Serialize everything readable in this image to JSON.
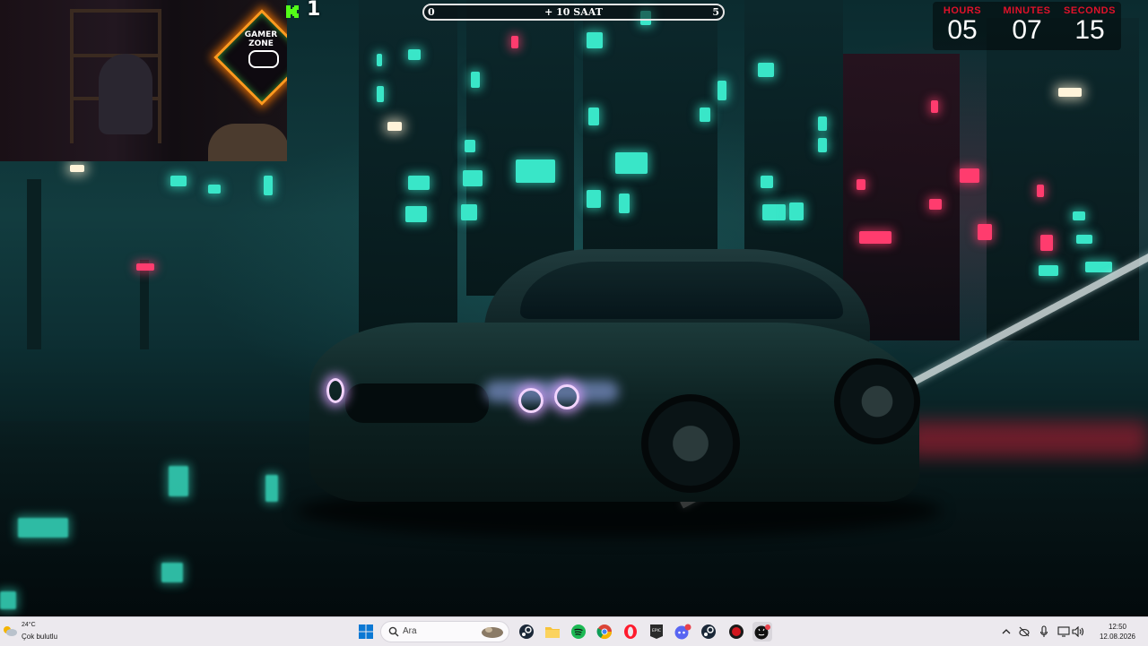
{
  "stream_overlay": {
    "kick_count": "1",
    "progress": {
      "start": "0",
      "end": "5",
      "label": "+ 10 SAAT",
      "fraction": 0.0
    },
    "countdown": {
      "hours_label": "HOURS",
      "hours": "05",
      "minutes_label": "MINUTES",
      "minutes": "07",
      "seconds_label": "SECONDS",
      "seconds": "15"
    },
    "webcam": {
      "sign_text_1": "GAMER",
      "sign_text_2": "ZONE"
    }
  },
  "taskbar": {
    "weather": {
      "temp": "24°C",
      "desc": "Çok bulutlu"
    },
    "search_placeholder": "Ara",
    "apps": [
      "windows-start",
      "search",
      "steam",
      "file-explorer",
      "spotify",
      "chrome",
      "opera",
      "epic-games",
      "discord",
      "steam",
      "red-app",
      "github"
    ],
    "clock": {
      "time": "12:50",
      "date": "12.08.2026"
    }
  },
  "colors": {
    "countdown_label": "#e0122a",
    "accent_teal": "#39e6c8",
    "accent_pink": "#ff3c6e"
  }
}
